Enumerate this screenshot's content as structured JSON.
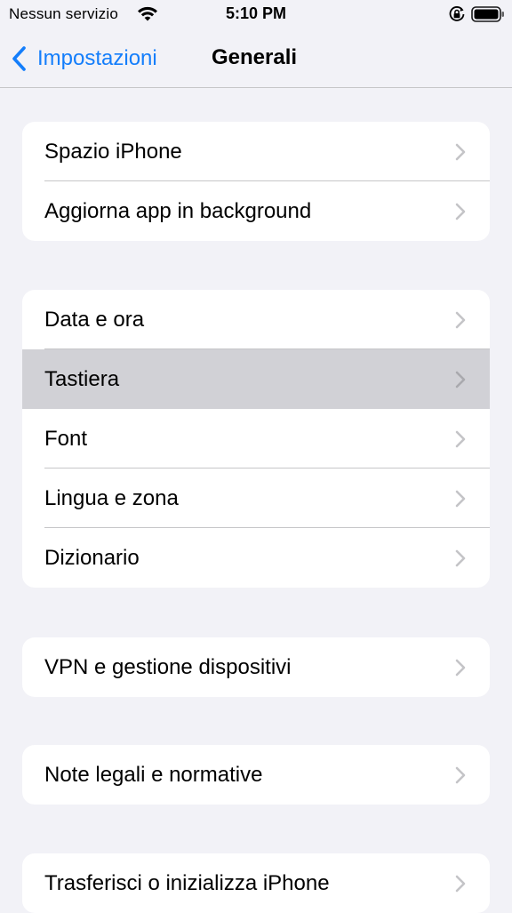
{
  "status": {
    "carrier": "Nessun servizio",
    "time": "5:10 PM"
  },
  "nav": {
    "back_label": "Impostazioni",
    "title": "Generali"
  },
  "groups": [
    {
      "items": [
        {
          "label": "Spazio iPhone"
        },
        {
          "label": "Aggiorna app in background"
        }
      ]
    },
    {
      "items": [
        {
          "label": "Data e ora"
        },
        {
          "label": "Tastiera",
          "highlighted": true
        },
        {
          "label": "Font"
        },
        {
          "label": "Lingua e zona"
        },
        {
          "label": "Dizionario"
        }
      ]
    },
    {
      "items": [
        {
          "label": "VPN e gestione dispositivi"
        }
      ]
    },
    {
      "items": [
        {
          "label": "Note legali e normative"
        }
      ]
    },
    {
      "items": [
        {
          "label": "Trasferisci o inizializza iPhone"
        }
      ]
    }
  ],
  "colors": {
    "accent": "#147efb",
    "background": "#f2f2f7",
    "cell": "#ffffff",
    "highlight": "#d1d1d6",
    "separator": "#c6c6c8",
    "chevron": "#c4c4c7"
  },
  "icons": {
    "status": [
      "wifi-icon",
      "orientation-lock-icon",
      "battery-icon"
    ],
    "back": "chevron-left-icon",
    "row": "chevron-right-icon"
  }
}
